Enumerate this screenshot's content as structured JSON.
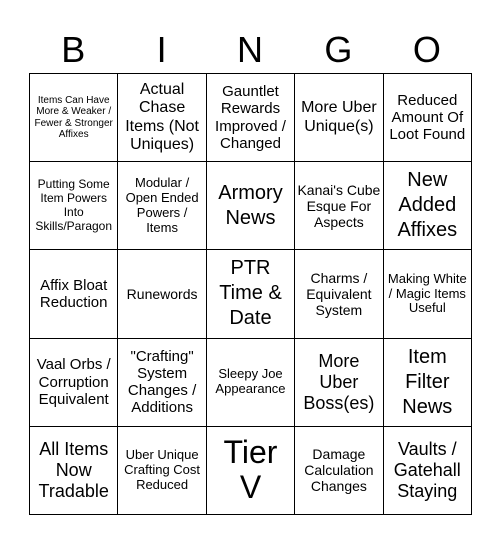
{
  "header": [
    "B",
    "I",
    "N",
    "G",
    "O"
  ],
  "cells": [
    "Items Can Have More & Weaker / Fewer & Stronger Affixes",
    "Actual Chase Items (Not Uniques)",
    "Gauntlet Rewards Improved / Changed",
    "More Uber Unique(s)",
    "Reduced Amount Of Loot Found",
    "Putting Some Item Powers Into Skills/Paragon",
    "Modular / Open Ended Powers / Items",
    "Armory News",
    "Kanai's Cube Esque For Aspects",
    "New Added Affixes",
    "Affix Bloat Reduction",
    "Runewords",
    "PTR Time & Date",
    "Charms / Equivalent System",
    "Making White / Magic Items Useful",
    "Vaal Orbs / Corruption Equivalent",
    "\"Crafting\" System Changes / Additions",
    "Sleepy Joe Appearance",
    "More Uber Boss(es)",
    "Item Filter News",
    "All Items Now Tradable",
    "Uber Unique Crafting Cost Reduced",
    "Tier V",
    "Damage Calculation Changes",
    "Vaults / Gatehall Staying"
  ]
}
